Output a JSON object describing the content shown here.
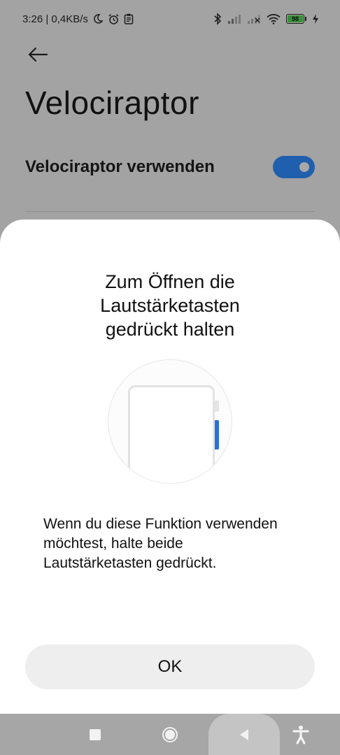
{
  "status_bar": {
    "time_speed": "3:26 | 0,4KB/s",
    "battery_level": "98"
  },
  "page": {
    "title": "Velociraptor",
    "setting_label": "Velociraptor verwenden",
    "toggle_on": true
  },
  "dialog": {
    "title": "Zum Öffnen die\nLautstärketasten\ngedrückt halten",
    "description": "Wenn du diese Funktion verwenden möchtest, halte beide Lautstärketasten gedrückt.",
    "ok_label": "OK"
  },
  "icons": {
    "back": "arrow-left-icon",
    "moon": "moon-icon",
    "alarm": "alarm-icon",
    "clipboard": "clipboard-icon",
    "bluetooth": "bluetooth-icon",
    "signal": "signal-icon",
    "wifi": "wifi-icon",
    "charging": "charging-bolt-icon"
  },
  "colors": {
    "toggle_accent": "#1f5fae",
    "volume_button": "#2a6fd8",
    "scrim": "#a3a3a3",
    "sheet": "#ffffff"
  }
}
